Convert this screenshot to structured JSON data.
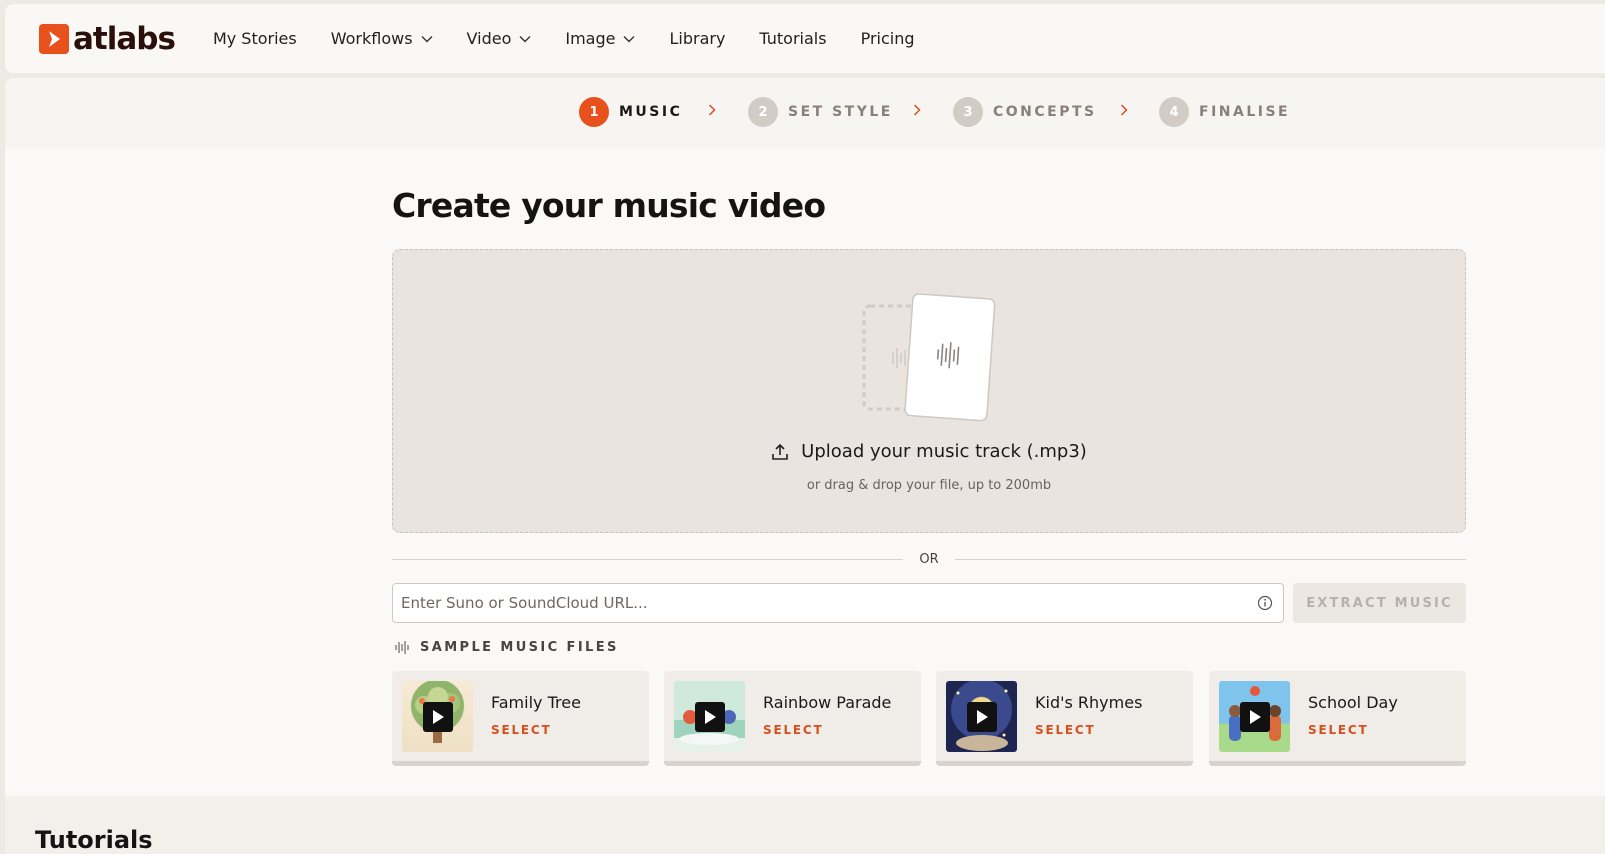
{
  "brand": {
    "name": "atlabs",
    "accent": "#e8501c"
  },
  "nav": {
    "items": [
      {
        "label": "My Stories",
        "dropdown": false
      },
      {
        "label": "Workflows",
        "dropdown": true
      },
      {
        "label": "Video",
        "dropdown": true
      },
      {
        "label": "Image",
        "dropdown": true
      },
      {
        "label": "Library",
        "dropdown": false
      },
      {
        "label": "Tutorials",
        "dropdown": false
      },
      {
        "label": "Pricing",
        "dropdown": false
      }
    ]
  },
  "steps": [
    {
      "num": "1",
      "label": "MUSIC",
      "active": true
    },
    {
      "num": "2",
      "label": "SET STYLE",
      "active": false
    },
    {
      "num": "3",
      "label": "CONCEPTS",
      "active": false
    },
    {
      "num": "4",
      "label": "FINALISE",
      "active": false
    }
  ],
  "page": {
    "title": "Create your music video"
  },
  "upload": {
    "label": "Upload your music track (.mp3)",
    "sub": "or drag & drop your file, up to 200mb"
  },
  "divider": {
    "text": "OR"
  },
  "url": {
    "placeholder": "Enter Suno or SoundCloud URL...",
    "value": ""
  },
  "extract": {
    "label": "EXTRACT MUSIC"
  },
  "samples": {
    "heading": "SAMPLE MUSIC FILES",
    "items": [
      {
        "title": "Family Tree",
        "action": "SELECT"
      },
      {
        "title": "Rainbow Parade",
        "action": "SELECT"
      },
      {
        "title": "Kid's Rhymes",
        "action": "SELECT"
      },
      {
        "title": "School Day",
        "action": "SELECT"
      }
    ]
  },
  "tutorials": {
    "title": "Tutorials"
  }
}
